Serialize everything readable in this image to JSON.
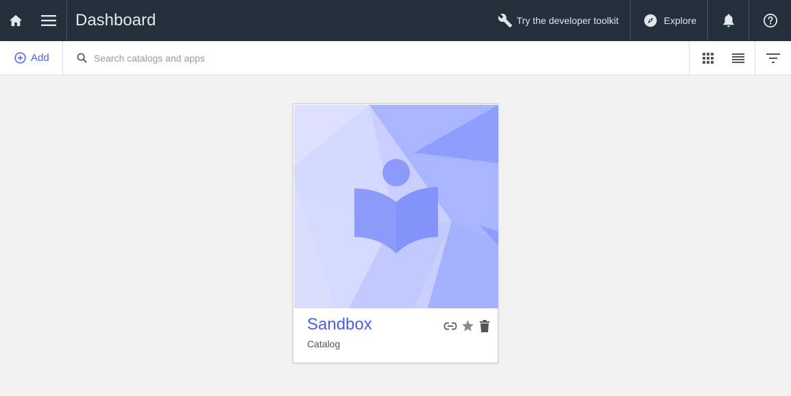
{
  "header": {
    "title": "Dashboard",
    "developer_toolkit_label": "Try the developer toolkit",
    "explore_label": "Explore"
  },
  "toolbar": {
    "add_label": "Add",
    "search_placeholder": "Search catalogs and apps"
  },
  "cards": [
    {
      "title": "Sandbox",
      "subtitle": "Catalog"
    }
  ],
  "colors": {
    "header_bg": "#232f3a",
    "accent": "#4a5ee8",
    "card_art": "#9aa8ff"
  }
}
